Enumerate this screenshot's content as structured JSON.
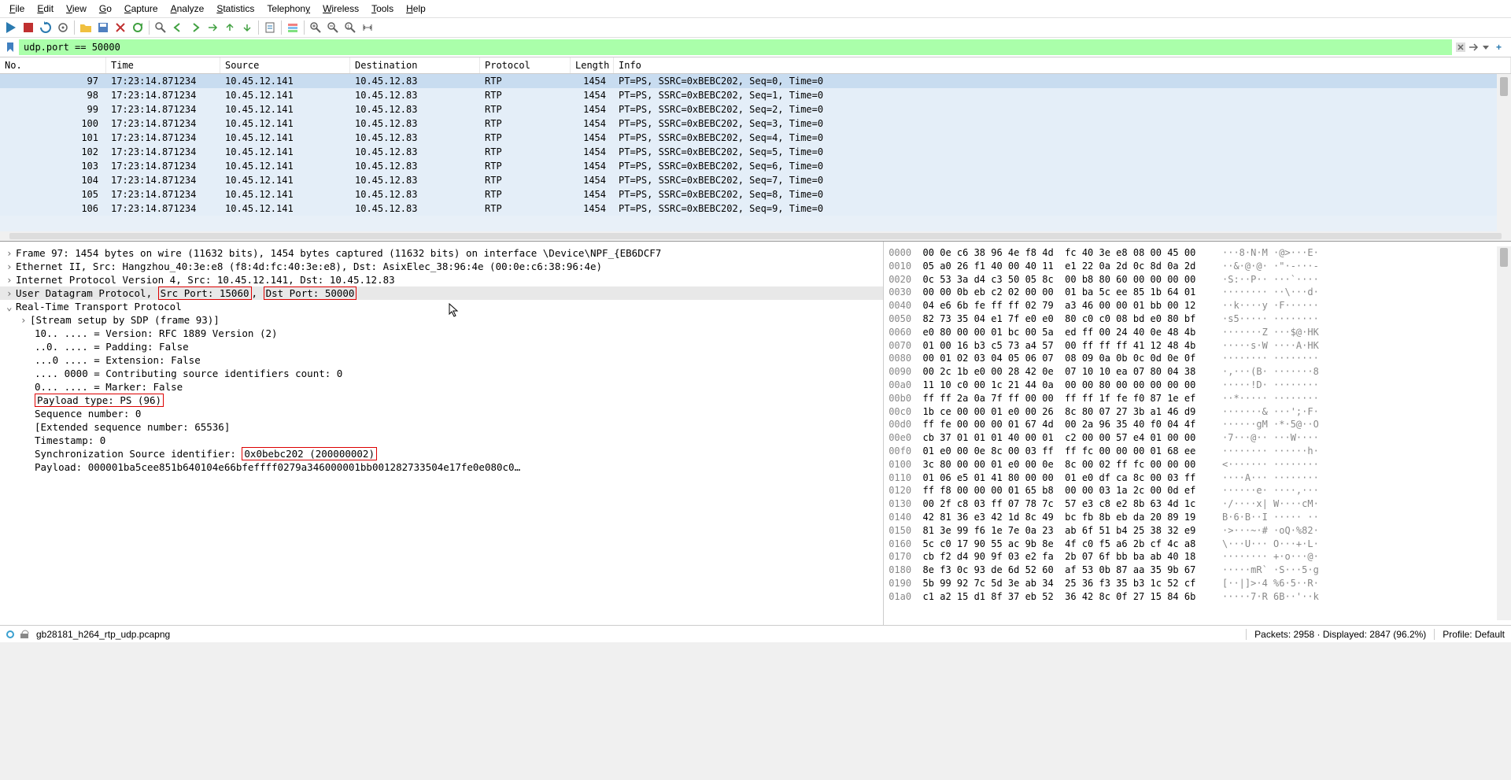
{
  "menu": {
    "file": "File",
    "edit": "Edit",
    "view": "View",
    "go": "Go",
    "capture": "Capture",
    "analyze": "Analyze",
    "statistics": "Statistics",
    "telephony": "Telephony",
    "wireless": "Wireless",
    "tools": "Tools",
    "help": "Help"
  },
  "filter": {
    "value": "udp.port == 50000"
  },
  "columns": {
    "no": "No.",
    "time": "Time",
    "src": "Source",
    "dst": "Destination",
    "proto": "Protocol",
    "len": "Length",
    "info": "Info"
  },
  "packets": [
    {
      "no": "97",
      "time": "17:23:14.871234",
      "src": "10.45.12.141",
      "dst": "10.45.12.83",
      "proto": "RTP",
      "len": "1454",
      "info": "PT=PS, SSRC=0xBEBC202, Seq=0, Time=0"
    },
    {
      "no": "98",
      "time": "17:23:14.871234",
      "src": "10.45.12.141",
      "dst": "10.45.12.83",
      "proto": "RTP",
      "len": "1454",
      "info": "PT=PS, SSRC=0xBEBC202, Seq=1, Time=0"
    },
    {
      "no": "99",
      "time": "17:23:14.871234",
      "src": "10.45.12.141",
      "dst": "10.45.12.83",
      "proto": "RTP",
      "len": "1454",
      "info": "PT=PS, SSRC=0xBEBC202, Seq=2, Time=0"
    },
    {
      "no": "100",
      "time": "17:23:14.871234",
      "src": "10.45.12.141",
      "dst": "10.45.12.83",
      "proto": "RTP",
      "len": "1454",
      "info": "PT=PS, SSRC=0xBEBC202, Seq=3, Time=0"
    },
    {
      "no": "101",
      "time": "17:23:14.871234",
      "src": "10.45.12.141",
      "dst": "10.45.12.83",
      "proto": "RTP",
      "len": "1454",
      "info": "PT=PS, SSRC=0xBEBC202, Seq=4, Time=0"
    },
    {
      "no": "102",
      "time": "17:23:14.871234",
      "src": "10.45.12.141",
      "dst": "10.45.12.83",
      "proto": "RTP",
      "len": "1454",
      "info": "PT=PS, SSRC=0xBEBC202, Seq=5, Time=0"
    },
    {
      "no": "103",
      "time": "17:23:14.871234",
      "src": "10.45.12.141",
      "dst": "10.45.12.83",
      "proto": "RTP",
      "len": "1454",
      "info": "PT=PS, SSRC=0xBEBC202, Seq=6, Time=0"
    },
    {
      "no": "104",
      "time": "17:23:14.871234",
      "src": "10.45.12.141",
      "dst": "10.45.12.83",
      "proto": "RTP",
      "len": "1454",
      "info": "PT=PS, SSRC=0xBEBC202, Seq=7, Time=0"
    },
    {
      "no": "105",
      "time": "17:23:14.871234",
      "src": "10.45.12.141",
      "dst": "10.45.12.83",
      "proto": "RTP",
      "len": "1454",
      "info": "PT=PS, SSRC=0xBEBC202, Seq=8, Time=0"
    },
    {
      "no": "106",
      "time": "17:23:14.871234",
      "src": "10.45.12.141",
      "dst": "10.45.12.83",
      "proto": "RTP",
      "len": "1454",
      "info": "PT=PS, SSRC=0xBEBC202, Seq=9, Time=0"
    }
  ],
  "details": {
    "frame": "Frame 97: 1454 bytes on wire (11632 bits), 1454 bytes captured (11632 bits) on interface \\Device\\NPF_{EB6DCF7",
    "eth": "Ethernet II, Src: Hangzhou_40:3e:e8 (f8:4d:fc:40:3e:e8), Dst: AsixElec_38:96:4e (00:0e:c6:38:96:4e)",
    "ip": "Internet Protocol Version 4, Src: 10.45.12.141, Dst: 10.45.12.83",
    "udp_pre": "User Datagram Protocol, ",
    "udp_src": "Src Port: 15060",
    "udp_sep": ", ",
    "udp_dst": "Dst Port: 50000",
    "rtp": "Real-Time Transport Protocol",
    "stream": "[Stream setup by SDP (frame 93)]",
    "ver": "10.. .... = Version: RFC 1889 Version (2)",
    "pad": "..0. .... = Padding: False",
    "ext": "...0 .... = Extension: False",
    "cc": ".... 0000 = Contributing source identifiers count: 0",
    "marker": "0... .... = Marker: False",
    "pt": "Payload type: PS (96)",
    "seq": "Sequence number: 0",
    "extseq": "[Extended sequence number: 65536]",
    "ts": "Timestamp: 0",
    "ssrc_pre": "Synchronization Source identifier: ",
    "ssrc_val": "0x0bebc202 (200000002)",
    "payload": "Payload: 000001ba5cee851b640104e66bfeffff0279a346000001bb001282733504e17fe0e080c0…"
  },
  "hex": [
    {
      "off": "0000",
      "b": "00 0e c6 38 96 4e f8 4d  fc 40 3e e8 08 00 45 00",
      "a": "···8·N·M ·@>···E·"
    },
    {
      "off": "0010",
      "b": "05 a0 26 f1 40 00 40 11  e1 22 0a 2d 0c 8d 0a 2d",
      "a": "··&·@·@· ·\"·-···-"
    },
    {
      "off": "0020",
      "b": "0c 53 3a d4 c3 50 05 8c  00 b8 80 60 00 00 00 00",
      "a": "·S:··P·· ···`····"
    },
    {
      "off": "0030",
      "b": "00 00 0b eb c2 02 00 00  01 ba 5c ee 85 1b 64 01",
      "a": "········ ··\\···d·"
    },
    {
      "off": "0040",
      "b": "04 e6 6b fe ff ff 02 79  a3 46 00 00 01 bb 00 12",
      "a": "··k····y ·F······"
    },
    {
      "off": "0050",
      "b": "82 73 35 04 e1 7f e0 e0  80 c0 c0 08 bd e0 80 bf",
      "a": "·s5····· ········"
    },
    {
      "off": "0060",
      "b": "e0 80 00 00 01 bc 00 5a  ed ff 00 24 40 0e 48 4b",
      "a": "·······Z ···$@·HK"
    },
    {
      "off": "0070",
      "b": "01 00 16 b3 c5 73 a4 57  00 ff ff ff 41 12 48 4b",
      "a": "·····s·W ····A·HK"
    },
    {
      "off": "0080",
      "b": "00 01 02 03 04 05 06 07  08 09 0a 0b 0c 0d 0e 0f",
      "a": "········ ········"
    },
    {
      "off": "0090",
      "b": "00 2c 1b e0 00 28 42 0e  07 10 10 ea 07 80 04 38",
      "a": "·,···(B· ·······8"
    },
    {
      "off": "00a0",
      "b": "11 10 c0 00 1c 21 44 0a  00 00 80 00 00 00 00 00",
      "a": "·····!D· ········"
    },
    {
      "off": "00b0",
      "b": "ff ff 2a 0a 7f ff 00 00  ff ff 1f fe f0 87 1e ef",
      "a": "··*····· ········"
    },
    {
      "off": "00c0",
      "b": "1b ce 00 00 01 e0 00 26  8c 80 07 27 3b a1 46 d9",
      "a": "·······& ···';·F·"
    },
    {
      "off": "00d0",
      "b": "ff fe 00 00 00 01 67 4d  00 2a 96 35 40 f0 04 4f",
      "a": "······gM ·*·5@··O"
    },
    {
      "off": "00e0",
      "b": "cb 37 01 01 01 40 00 01  c2 00 00 57 e4 01 00 00",
      "a": "·7···@·· ···W····"
    },
    {
      "off": "00f0",
      "b": "01 e0 00 0e 8c 00 03 ff  ff fc 00 00 00 01 68 ee",
      "a": "········ ······h·"
    },
    {
      "off": "0100",
      "b": "3c 80 00 00 01 e0 00 0e  8c 00 02 ff fc 00 00 00",
      "a": "<······· ········"
    },
    {
      "off": "0110",
      "b": "01 06 e5 01 41 80 00 00  01 e0 df ca 8c 00 03 ff",
      "a": "····A··· ········"
    },
    {
      "off": "0120",
      "b": "ff f8 00 00 00 01 65 b8  00 00 03 1a 2c 00 0d ef",
      "a": "······e· ····,···"
    },
    {
      "off": "0130",
      "b": "00 2f c8 03 ff 07 78 7c  57 e3 c8 e2 8b 63 4d 1c",
      "a": "·/····x| W····cM·"
    },
    {
      "off": "0140",
      "b": "42 81 36 e3 42 1d 8c 49  bc fb 8b eb da 20 89 19",
      "a": "B·6·B··I ····· ··"
    },
    {
      "off": "0150",
      "b": "81 3e 99 f6 1e 7e 0a 23  ab 6f 51 b4 25 38 32 e9",
      "a": "·>···~·# ·oQ·%82·"
    },
    {
      "off": "0160",
      "b": "5c c0 17 90 55 ac 9b 8e  4f c0 f5 a6 2b cf 4c a8",
      "a": "\\···U··· O···+·L·"
    },
    {
      "off": "0170",
      "b": "cb f2 d4 90 9f 03 e2 fa  2b 07 6f bb ba ab 40 18",
      "a": "········ +·o···@·"
    },
    {
      "off": "0180",
      "b": "8e f3 0c 93 de 6d 52 60  af 53 0b 87 aa 35 9b 67",
      "a": "·····mR` ·S···5·g"
    },
    {
      "off": "0190",
      "b": "5b 99 92 7c 5d 3e ab 34  25 36 f3 35 b3 1c 52 cf",
      "a": "[··|]>·4 %6·5··R·"
    },
    {
      "off": "01a0",
      "b": "c1 a2 15 d1 8f 37 eb 52  36 42 8c 0f 27 15 84 6b",
      "a": "·····7·R 6B··'··k"
    }
  ],
  "status": {
    "file": "gb28181_h264_rtp_udp.pcapng",
    "packets": "Packets: 2958  ·  Displayed: 2847 (96.2%)",
    "profile": "Profile: Default"
  }
}
